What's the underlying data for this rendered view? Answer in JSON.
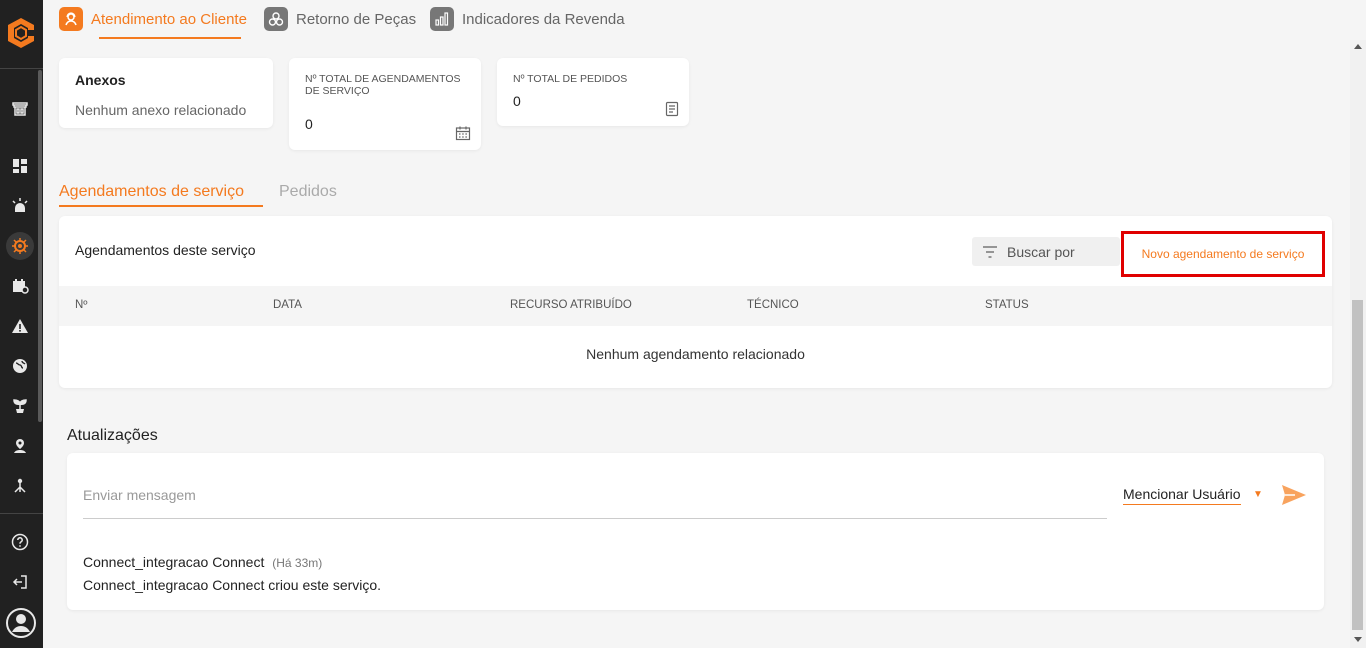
{
  "top_tabs": [
    {
      "label": "Atendimento ao Cliente",
      "icon": "support-agent-icon"
    },
    {
      "label": "Retorno de Peças",
      "icon": "parts-icon"
    },
    {
      "label": "Indicadores da Revenda",
      "icon": "bar-chart-icon"
    }
  ],
  "sidebar": {
    "items": [
      {
        "icon": "store-icon"
      },
      {
        "icon": "dashboard-icon"
      },
      {
        "icon": "alarm-icon"
      },
      {
        "icon": "service-gear-icon"
      },
      {
        "icon": "calendar-icon"
      },
      {
        "icon": "warning-icon"
      },
      {
        "icon": "globe-icon"
      },
      {
        "icon": "plant-icon"
      },
      {
        "icon": "location-person-icon"
      },
      {
        "icon": "hierarchy-icon"
      },
      {
        "icon": "help-icon"
      },
      {
        "icon": "logout-icon"
      },
      {
        "icon": "user-account-icon"
      }
    ]
  },
  "cards": {
    "anexos": {
      "title": "Anexos",
      "subtitle": "Nenhum anexo relacionado"
    },
    "agendamentos": {
      "label": "Nº TOTAL DE AGENDAMENTOS DE SERVIÇO",
      "value": "0"
    },
    "pedidos": {
      "label": "Nº TOTAL DE PEDIDOS",
      "value": "0"
    }
  },
  "section_tabs": [
    {
      "label": "Agendamentos de serviço"
    },
    {
      "label": "Pedidos"
    }
  ],
  "table": {
    "title": "Agendamentos deste serviço",
    "search_placeholder": "Buscar por",
    "new_button": "Novo agendamento de serviço",
    "columns": [
      "Nº",
      "DATA",
      "RECURSO ATRIBUÍDO",
      "TÉCNICO",
      "STATUS"
    ],
    "empty_text": "Nenhum agendamento relacionado"
  },
  "updates": {
    "title": "Atualizações",
    "input_placeholder": "Enviar mensagem",
    "mention_label": "Mencionar Usuário",
    "entries": [
      {
        "author": "Connect_integracao Connect",
        "time": "(Há 33m)",
        "text": "Connect_integracao Connect criou este serviço."
      }
    ]
  },
  "colors": {
    "accent": "#f47a1f",
    "sidebar_bg": "#212121",
    "highlight_border": "#e00000"
  }
}
